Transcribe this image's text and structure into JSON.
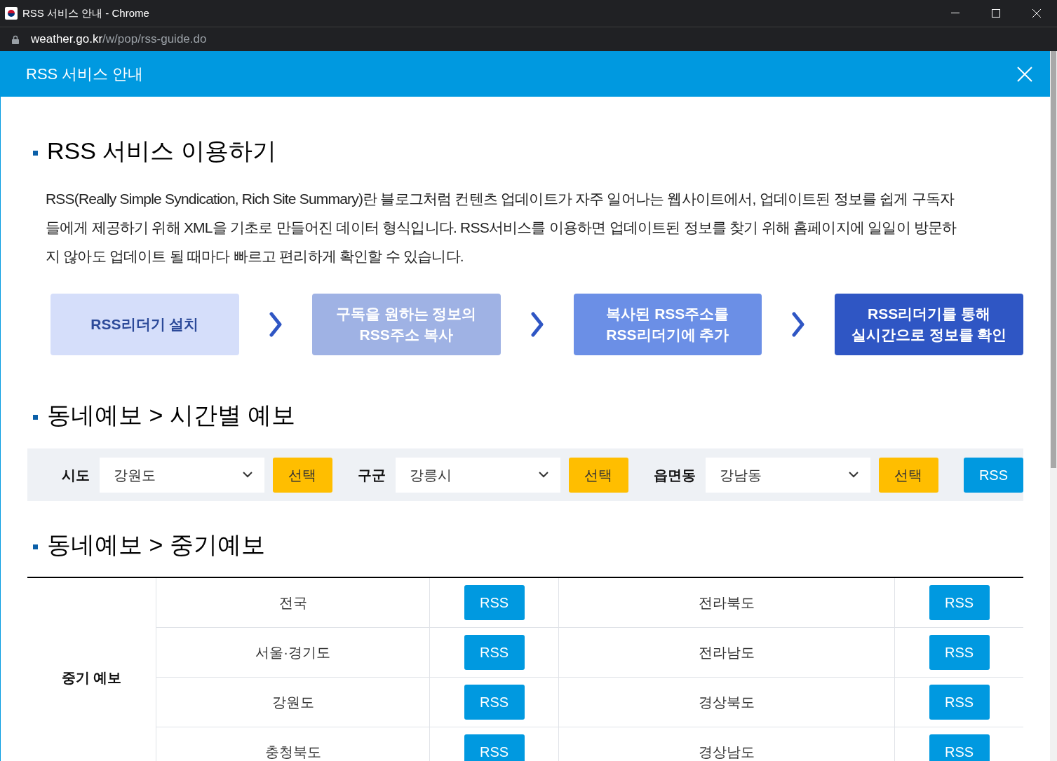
{
  "window": {
    "title": "RSS 서비스 안내 - Chrome",
    "address_domain": "weather.go.kr",
    "address_path": "/w/pop/rss-guide.do"
  },
  "dialog": {
    "title": "RSS 서비스 안내"
  },
  "intro": {
    "heading": "RSS 서비스 이용하기",
    "paragraph": "RSS(Really Simple Syndication, Rich Site Summary)란 블로그처럼 컨텐츠 업데이트가 자주 일어나는 웹사이트에서, 업데이트된 정보를 쉽게 구독자들에게 제공하기 위해 XML을 기초로 만들어진 데이터 형식입니다. RSS서비스를 이용하면 업데이트된 정보를 찾기 위해 홈페이지에 일일이 방문하지 않아도 업데이트 될 때마다 빠르고 편리하게 확인할 수 있습니다.",
    "steps": [
      {
        "text": "RSS리더기 설치",
        "color": "#d5defa"
      },
      {
        "text": "구독을 원하는 정보의\nRSS주소 복사",
        "color": "#9fb2e4"
      },
      {
        "text": "복사된 RSS주소를\nRSS리더기에 추가",
        "color": "#6b8fe6"
      },
      {
        "text": "RSS리더기를 통해\n실시간으로 정보를 확인",
        "color": "#2f56c4"
      }
    ]
  },
  "hourly": {
    "heading": "동네예보 > 시간별 예보",
    "filters": [
      {
        "label": "시도",
        "value": "강원도",
        "button": "선택"
      },
      {
        "label": "구군",
        "value": "강릉시",
        "button": "선택"
      },
      {
        "label": "읍면동",
        "value": "강남동",
        "button": "선택"
      }
    ],
    "rss_button": "RSS"
  },
  "midterm": {
    "heading": "동네예보 > 중기예보",
    "row_header": "중기 예보",
    "rows": [
      {
        "left": "전국",
        "left_button": "RSS",
        "right": "전라북도",
        "right_button": "RSS"
      },
      {
        "left": "서울·경기도",
        "left_button": "RSS",
        "right": "전라남도",
        "right_button": "RSS"
      },
      {
        "left": "강원도",
        "left_button": "RSS",
        "right": "경상북도",
        "right_button": "RSS"
      },
      {
        "left": "충청북도",
        "left_button": "RSS",
        "right": "경상남도",
        "right_button": "RSS"
      }
    ]
  }
}
